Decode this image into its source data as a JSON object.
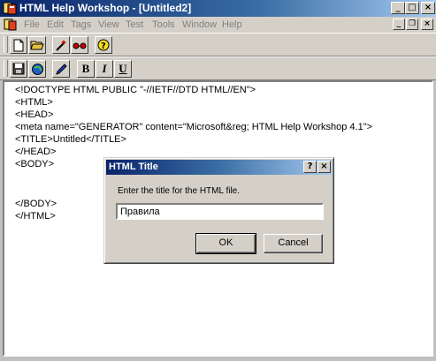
{
  "window": {
    "title": "HTML Help Workshop - [Untitled2]",
    "controls": {
      "minimize": "_",
      "maximize": "□",
      "close": "×"
    }
  },
  "menu": {
    "items": [
      "File",
      "Edit",
      "Tags",
      "View",
      "Test",
      "Tools",
      "Window",
      "Help"
    ],
    "mdi_controls": {
      "minimize": "_",
      "restore": "❐",
      "close": "×"
    }
  },
  "toolbar": {
    "format_labels": {
      "bold": "B",
      "italic": "I",
      "underline": "U"
    }
  },
  "editor": {
    "lines": [
      "<!DOCTYPE HTML PUBLIC \"-//IETF//DTD HTML//EN\">",
      "<HTML>",
      "<HEAD>",
      "<meta name=\"GENERATOR\" content=\"Microsoft&reg; HTML Help Workshop 4.1\">",
      "<TITLE>Untitled</TITLE>",
      "</HEAD>",
      "<BODY>",
      "",
      "",
      "</BODY>",
      "</HTML>"
    ]
  },
  "dialog": {
    "title": "HTML Title",
    "help_button": "?",
    "close_button": "×",
    "prompt": "Enter the title for the HTML file.",
    "input_value": "Правила",
    "ok_label": "OK",
    "cancel_label": "Cancel"
  }
}
